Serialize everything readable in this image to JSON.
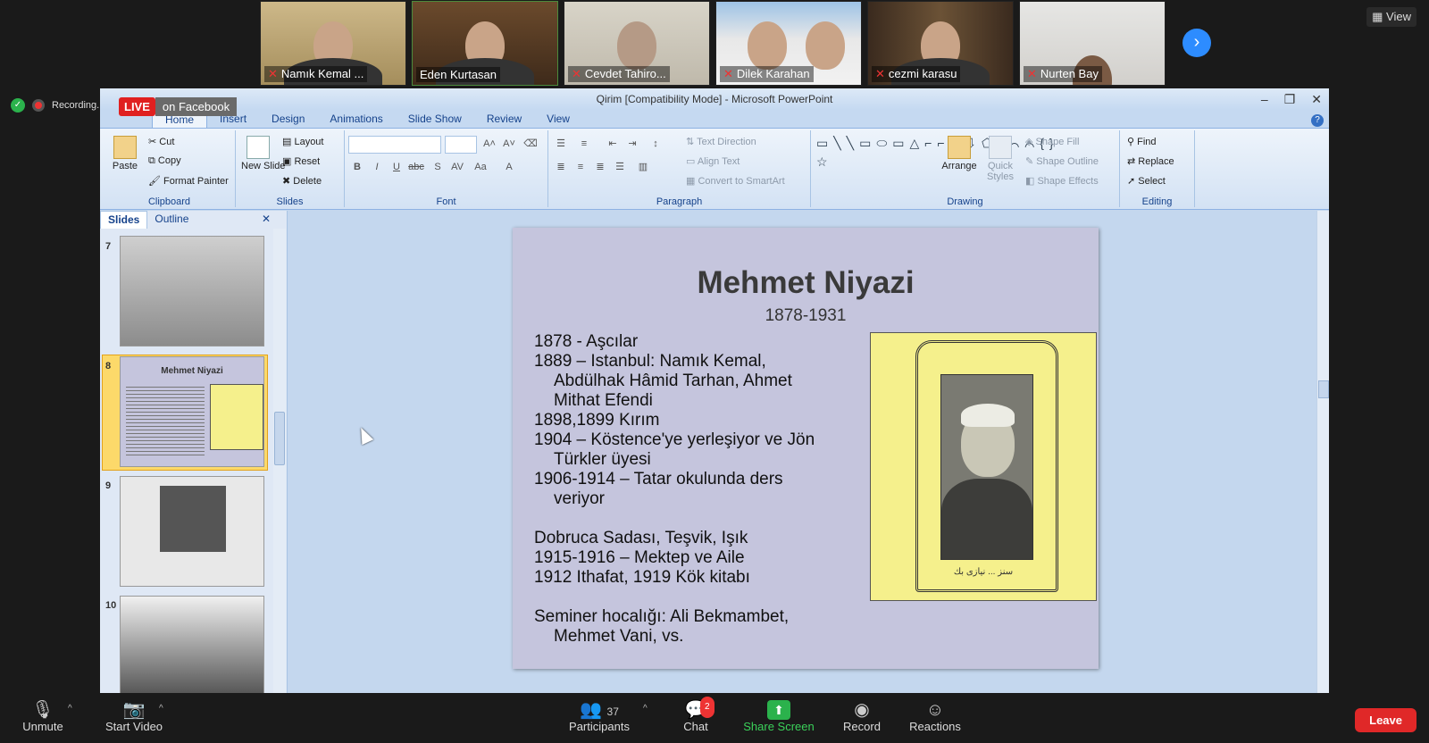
{
  "participants": [
    {
      "name": "Namık Kemal ...",
      "muted": true
    },
    {
      "name": "Eden Kurtasan",
      "muted": false
    },
    {
      "name": "Cevdet Tahiro...",
      "muted": true
    },
    {
      "name": "Dilek Karahan",
      "muted": true
    },
    {
      "name": "cezmi karasu",
      "muted": true
    },
    {
      "name": "Nurten Bay",
      "muted": true
    }
  ],
  "view_label": "View",
  "recording_label": "Recording...",
  "live": {
    "badge": "LIVE",
    "platform": "on Facebook"
  },
  "powerpoint": {
    "window_title": "Qirim [Compatibility Mode] - Microsoft PowerPoint",
    "tabs": [
      "Home",
      "Insert",
      "Design",
      "Animations",
      "Slide Show",
      "Review",
      "View"
    ],
    "active_tab": "Home",
    "groups": {
      "clipboard": {
        "name": "Clipboard",
        "paste": "Paste",
        "cut": "Cut",
        "copy": "Copy",
        "format_painter": "Format Painter"
      },
      "slides": {
        "name": "Slides",
        "new_slide": "New Slide",
        "layout": "Layout",
        "reset": "Reset",
        "delete": "Delete"
      },
      "font": {
        "name": "Font"
      },
      "paragraph": {
        "name": "Paragraph",
        "text_direction": "Text Direction",
        "align_text": "Align Text",
        "convert_smartart": "Convert to SmartArt"
      },
      "drawing": {
        "name": "Drawing",
        "arrange": "Arrange",
        "quick_styles": "Quick Styles",
        "shape_fill": "Shape Fill",
        "shape_outline": "Shape Outline",
        "shape_effects": "Shape Effects"
      },
      "editing": {
        "name": "Editing",
        "find": "Find",
        "replace": "Replace",
        "select": "Select"
      }
    },
    "pane_tabs": {
      "slides": "Slides",
      "outline": "Outline"
    },
    "thumbnails": [
      {
        "number": "7"
      },
      {
        "number": "8",
        "title": "Mehmet Niyazi",
        "selected": true
      },
      {
        "number": "9"
      },
      {
        "number": "10"
      }
    ],
    "slide": {
      "title": "Mehmet Niyazi",
      "subtitle": "1878-1931",
      "lines": [
        {
          "text": "1878 - Aşcılar",
          "indent": false
        },
        {
          "text": "1889 – Istanbul: Namık Kemal,",
          "indent": false
        },
        {
          "text": "Abdülhak Hâmid Tarhan, Ahmet",
          "indent": true
        },
        {
          "text": "Mithat Efendi",
          "indent": true
        },
        {
          "text": "1898,1899 Kırım",
          "indent": false
        },
        {
          "text": "1904 – Köstence'ye yerleşiyor ve Jön",
          "indent": false
        },
        {
          "text": "Türkler üyesi",
          "indent": true
        },
        {
          "text": "1906-1914 – Tatar okulunda ders",
          "indent": false
        },
        {
          "text": "veriyor",
          "indent": true
        },
        {
          "text": "",
          "indent": false
        },
        {
          "text": "Dobruca Sadası, Teşvik, Işık",
          "indent": false
        },
        {
          "text": "1915-1916 – Mektep ve Aile",
          "indent": false
        },
        {
          "text": "1912 Ithafat, 1919 Kök kitabı",
          "indent": false
        },
        {
          "text": "",
          "indent": false
        },
        {
          "text": "Seminer hocalığı: Ali Bekmambet,",
          "indent": false
        },
        {
          "text": "Mehmet Vani, vs.",
          "indent": true
        }
      ],
      "photo_caption": "سنز ... نیازی بك"
    }
  },
  "toolbar": {
    "unmute": "Unmute",
    "start_video": "Start Video",
    "participants": "Participants",
    "participants_count": "37",
    "chat": "Chat",
    "chat_badge": "2",
    "share_screen": "Share Screen",
    "record": "Record",
    "reactions": "Reactions",
    "leave": "Leave"
  },
  "colors": {
    "accent": "#2d8cff",
    "share": "#2bb24c",
    "leave": "#e02828",
    "live": "#e02020"
  }
}
